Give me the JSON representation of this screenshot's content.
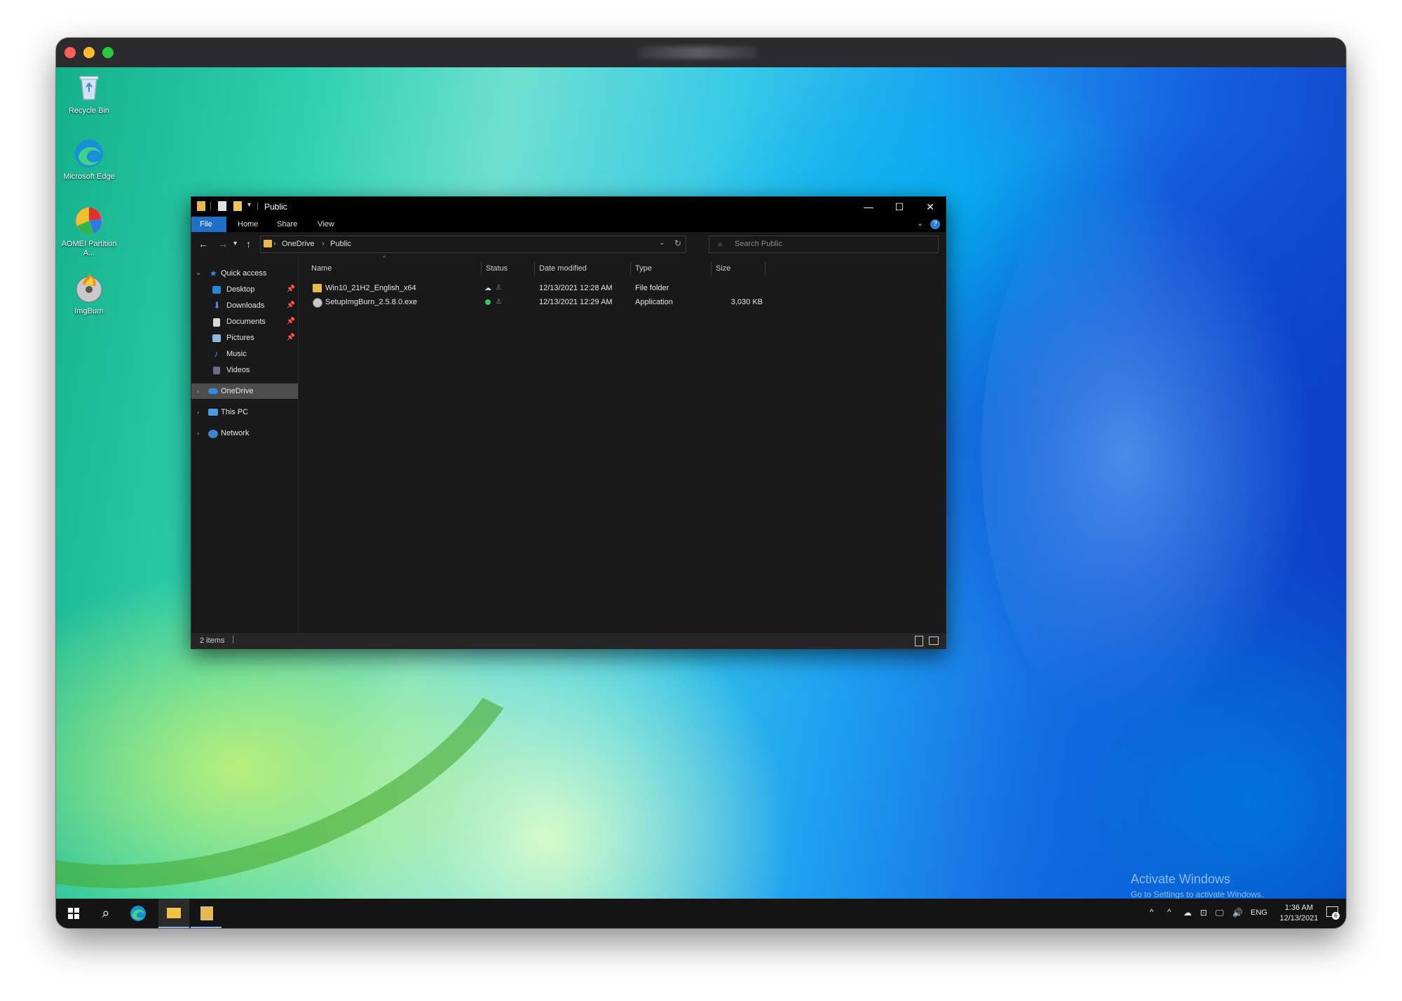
{
  "desktop": {
    "icons": [
      {
        "label": "Recycle Bin"
      },
      {
        "label": "Microsoft Edge"
      },
      {
        "label": "AOMEI Partition A..."
      },
      {
        "label": "ImgBurn"
      }
    ],
    "watermark": {
      "title": "Activate Windows",
      "subtitle": "Go to Settings to activate Windows."
    }
  },
  "explorer": {
    "title": "Public",
    "ribbon_tabs": [
      "File",
      "Home",
      "Share",
      "View"
    ],
    "address": {
      "root": "OneDrive",
      "current": "Public"
    },
    "search_placeholder": "Search Public",
    "nav": {
      "quick_access": "Quick access",
      "quick_items": [
        "Desktop",
        "Downloads",
        "Documents",
        "Pictures",
        "Music",
        "Videos"
      ],
      "onedrive": "OneDrive",
      "this_pc": "This PC",
      "network": "Network"
    },
    "columns": [
      "Name",
      "Status",
      "Date modified",
      "Type",
      "Size"
    ],
    "files": [
      {
        "name": "Win10_21H2_English_x64",
        "date": "12/13/2021 12:28 AM",
        "type": "File folder",
        "size": ""
      },
      {
        "name": "SetupImgBurn_2.5.8.0.exe",
        "date": "12/13/2021 12:29 AM",
        "type": "Application",
        "size": "3,030 KB"
      }
    ],
    "status_text": "2 items"
  },
  "taskbar": {
    "lang": "ENG",
    "time": "1:36 AM",
    "date": "12/13/2021",
    "notification_count": "6"
  },
  "colors": {
    "accent": "#1f6fc9",
    "explorer_bg": "#191919",
    "titlebar": "#000000"
  }
}
